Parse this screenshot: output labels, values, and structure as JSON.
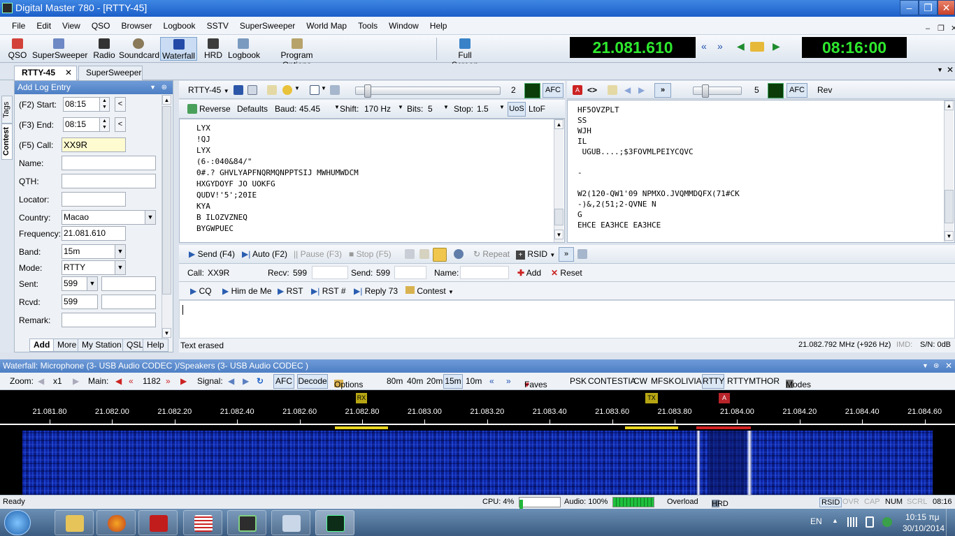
{
  "window": {
    "title": "Digital Master 780 - [RTTY-45]",
    "min": "–",
    "restore": "❐",
    "close": "✕"
  },
  "menu": [
    "File",
    "Edit",
    "View",
    "QSO",
    "Browser",
    "Logbook",
    "SSTV",
    "SuperSweeper",
    "World Map",
    "Tools",
    "Window",
    "Help"
  ],
  "toolbar": {
    "buttons": [
      {
        "label": "QSO",
        "icon": "qso-icon"
      },
      {
        "label": "SuperSweeper",
        "icon": "supersweeper-icon"
      },
      {
        "label": "Radio",
        "icon": "radio-icon"
      },
      {
        "label": "Soundcard",
        "icon": "soundcard-icon"
      },
      {
        "label": "Waterfall",
        "icon": "waterfall-icon"
      },
      {
        "label": "HRD",
        "icon": "hrd-icon"
      },
      {
        "label": "Logbook",
        "icon": "logbook-icon"
      },
      {
        "label": "Program Options",
        "icon": "program-options-icon"
      },
      {
        "label": "Full Screen",
        "icon": "full-screen-icon"
      }
    ],
    "frequency_display": "21.081.610",
    "clock_display": "08:16:00",
    "nav_back": "«",
    "nav_fwd": "»",
    "play_back": "◀",
    "play_fwd": "▶"
  },
  "doc_tabs": {
    "active": "RTTY-45",
    "other": "SuperSweeper",
    "close": "✕"
  },
  "side_tabs": {
    "tags": "Tags",
    "contest": "Contest"
  },
  "log_entry": {
    "title": "Add Log Entry",
    "start_label": "(F2)  Start:",
    "start_value": "08:15",
    "end_label": "(F3)  End:",
    "end_value": "08:15",
    "call_label": "(F5)  Call:",
    "call_value": "XX9R",
    "name_label": "Name:",
    "qth_label": "QTH:",
    "locator_label": "Locator:",
    "country_label": "Country:",
    "country_value": "Macao",
    "frequency_label": "Frequency:",
    "frequency_value": "21.081.610",
    "band_label": "Band:",
    "band_value": "15m",
    "mode_label": "Mode:",
    "mode_value": "RTTY",
    "sent_label": "Sent:",
    "sent_value": "599",
    "rcvd_label": "Rcvd:",
    "rcvd_value": "599",
    "remark_label": "Remark:",
    "tabs": [
      "Add",
      "More",
      "My Station",
      "QSL",
      "Help"
    ]
  },
  "rx_left": {
    "mode": "RTTY-45",
    "slider_value": "2",
    "afc": "AFC",
    "lines": [
      "LYX",
      "!QJ",
      "LYX",
      "(6-:040&84/\"",
      "0#.? GHVLYAPFNQRMQNPPTSIJ MWHUMWDCM",
      "HXGYDOYF JO UOKFG",
      "QUDV!'5';20IE",
      "KYA",
      "B ILOZVZNEQ",
      "BYGWPUEC"
    ]
  },
  "settings_bar": {
    "reverse": "Reverse",
    "defaults": "Defaults",
    "baud_label": "Baud:",
    "baud_value": "45.45",
    "shift_label": "Shift:",
    "shift_value": "170 Hz",
    "bits_label": "Bits:",
    "bits_value": "5",
    "stop_label": "Stop:",
    "stop_value": "1.5",
    "uos": "UoS",
    "ltof": "LtoF"
  },
  "rx_right": {
    "slider_value": "5",
    "afc": "AFC",
    "rev": "Rev",
    "lines": [
      "HF5OVZPLT",
      "SS",
      "WJH",
      "IL",
      " UGUB....;$3FOVMLPEIYCQVC",
      "",
      "-",
      "",
      "W2(120-QW1'09 NPMXO.JVQMMDQFX(71#CK",
      "-)&,2(51;2-QVNE N",
      "G",
      "EHCE EA3HCE EA3HCE"
    ]
  },
  "tx_bar": {
    "send": "Send  (F4)",
    "auto": "Auto  (F2)",
    "pause": "Pause  (F3)",
    "stop": "Stop  (F5)",
    "repeat": "Repeat",
    "rsid": "RSID"
  },
  "qso_bar": {
    "call_label": "Call:",
    "call_value": "XX9R",
    "recv_label": "Recv:",
    "recv_value": "599",
    "send_label": "Send:",
    "send_value": "599",
    "name_label": "Name:",
    "add": "Add",
    "reset": "Reset"
  },
  "macros": [
    {
      "label": "CQ"
    },
    {
      "label": "Him de Me"
    },
    {
      "label": "RST"
    },
    {
      "label": "RST #"
    },
    {
      "label": "Reply  73"
    },
    {
      "label": "Contest"
    }
  ],
  "status_line": {
    "left": "Text erased",
    "freq": "21.082.792 MHz (+926 Hz)",
    "imd": "IMD:",
    "sn": "S/N: 0dB"
  },
  "waterfall": {
    "title": "Waterfall: Microphone (3- USB Audio CODEC )/Speakers (3- USB Audio CODEC )",
    "zoom_label": "Zoom:",
    "zoom_value": "x1",
    "main_label": "Main:",
    "main_value": "1182",
    "signal_label": "Signal:",
    "afc": "AFC",
    "decode": "Decode",
    "options": "Options",
    "bands": [
      "80m",
      "40m",
      "20m",
      "15m",
      "10m"
    ],
    "faves": "Faves",
    "modes": [
      "PSK",
      "CONTESTIA",
      "CW",
      "MFSK",
      "OLIVIA",
      "RTTY",
      "RTTYM",
      "THOR"
    ],
    "modes_label": "Modes",
    "ticks": [
      "21.081.80",
      "21.082.00",
      "21.082.20",
      "21.082.40",
      "21.082.60",
      "21.082.80",
      "21.083.00",
      "21.083.20",
      "21.083.40",
      "21.083.60",
      "21.083.80",
      "21.084.00",
      "21.084.20",
      "21.084.40",
      "21.084.60"
    ],
    "markers": {
      "rx": "RX",
      "tx": "TX",
      "a": "A"
    }
  },
  "statusbar": {
    "ready": "Ready",
    "cpu": "CPU: 4%",
    "audio": "Audio: 100%",
    "overload": "Overload",
    "logbook": "HRD Logbook: My Logbook",
    "rsid": "RSID",
    "ovr": "OVR",
    "cap": "CAP",
    "num": "NUM",
    "scrl": "SCRL",
    "time": "08:16"
  },
  "taskbar": {
    "lang": "EN",
    "time": "10:15 πμ",
    "date": "30/10/2014"
  }
}
